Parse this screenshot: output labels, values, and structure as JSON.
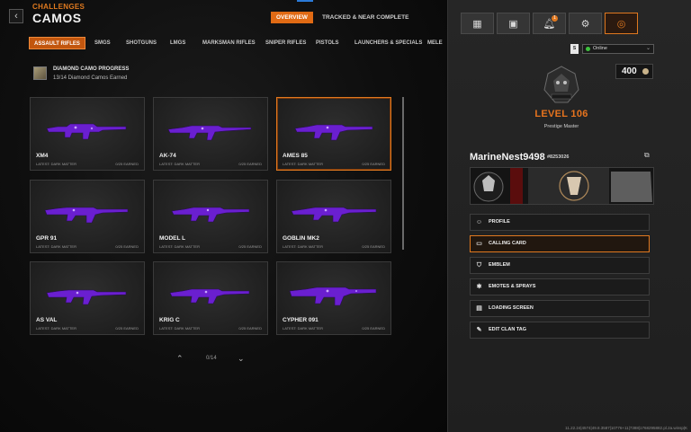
{
  "header": {
    "breadcrumb": "CHALLENGES",
    "title": "CAMOS",
    "back_icon": "chevron-left-icon",
    "tabs": [
      {
        "label": "OVERVIEW",
        "active": true
      },
      {
        "label": "TRACKED & NEAR COMPLETE",
        "active": false
      }
    ]
  },
  "categories": [
    {
      "label": "ASSAULT RIFLES",
      "active": true
    },
    {
      "label": "SMGS",
      "active": false
    },
    {
      "label": "SHOTGUNS",
      "active": false
    },
    {
      "label": "LMGS",
      "active": false
    },
    {
      "label": "MARKSMAN RIFLES",
      "active": false
    },
    {
      "label": "SNIPER RIFLES",
      "active": false
    },
    {
      "label": "PISTOLS",
      "active": false
    },
    {
      "label": "LAUNCHERS & SPECIALS",
      "active": false
    },
    {
      "label": "MELEE",
      "active": false
    }
  ],
  "progress": {
    "title": "DIAMOND CAMO PROGRESS",
    "subtitle": "13/14 Diamond Camos Earned"
  },
  "weapons": [
    {
      "name": "XM4",
      "sub": "LATEST: DARK MATTER",
      "earned": "0/25 EARNED",
      "selected": false
    },
    {
      "name": "AK-74",
      "sub": "LATEST: DARK MATTER",
      "earned": "0/25 EARNED",
      "selected": false
    },
    {
      "name": "AMES 85",
      "sub": "LATEST: DARK MATTER",
      "earned": "0/25 EARNED",
      "selected": true
    },
    {
      "name": "GPR 91",
      "sub": "LATEST: DARK MATTER",
      "earned": "0/25 EARNED",
      "selected": false
    },
    {
      "name": "MODEL L",
      "sub": "LATEST: DARK MATTER",
      "earned": "0/25 EARNED",
      "selected": false
    },
    {
      "name": "GOBLIN MK2",
      "sub": "LATEST: DARK MATTER",
      "earned": "0/25 EARNED",
      "selected": false
    },
    {
      "name": "AS VAL",
      "sub": "LATEST: DARK MATTER",
      "earned": "0/25 EARNED",
      "selected": false
    },
    {
      "name": "KRIG C",
      "sub": "LATEST: DARK MATTER",
      "earned": "0/25 EARNED",
      "selected": false
    },
    {
      "name": "CYPHER 091",
      "sub": "LATEST: DARK MATTER",
      "earned": "0/25 EARNED",
      "selected": false
    }
  ],
  "pager": {
    "text": "0/14"
  },
  "right_icons": [
    "grid-icon",
    "barracks-icon",
    "bell-icon",
    "gear-icon",
    "profile-ring-icon"
  ],
  "notification_count": "1",
  "status": {
    "badge": "S",
    "label": "Online"
  },
  "profile": {
    "level": "LEVEL 106",
    "prestige": "Prestige Master",
    "cod_points": "400",
    "gamertag": "MarineNest9498",
    "gamertag_id": "#8253026"
  },
  "menu": [
    {
      "label": "PROFILE",
      "icon": "profile-icon",
      "selected": false
    },
    {
      "label": "CALLING CARD",
      "icon": "calling-card-icon",
      "selected": true
    },
    {
      "label": "EMBLEM",
      "icon": "emblem-icon",
      "selected": false
    },
    {
      "label": "EMOTES & SPRAYS",
      "icon": "emote-icon",
      "selected": false
    },
    {
      "label": "LOADING SCREEN",
      "icon": "loading-screen-icon",
      "selected": false
    },
    {
      "label": "EDIT CLAN TAG",
      "icon": "clan-tag-icon",
      "selected": false
    }
  ],
  "build_info": "11.22.24|4574|49.8.3587|10776+11|7388|1768295882.pl.2a.winsp|K",
  "colors": {
    "accent": "#e0781f",
    "camo": "#6a1fd0",
    "online": "#3ec23e"
  }
}
